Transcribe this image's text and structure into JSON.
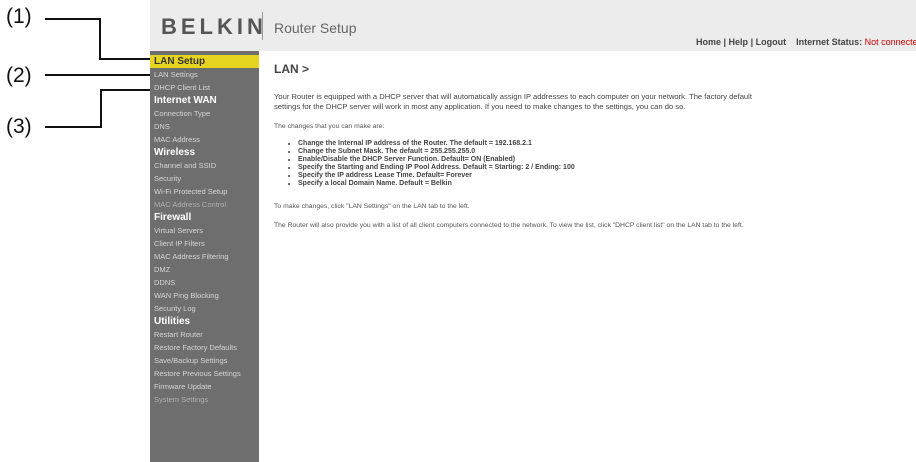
{
  "callouts": [
    "(1)",
    "(2)",
    "(3)"
  ],
  "header": {
    "logo": "BELKIN",
    "title": "Router Setup",
    "links": [
      "Home",
      "Help",
      "Logout"
    ],
    "status_label": "Internet Status:",
    "status_value": "Not connected"
  },
  "sidebar": {
    "lan_setup": {
      "title": "LAN Setup",
      "items": [
        "LAN Settings",
        "DHCP Client List"
      ]
    },
    "internet_wan": {
      "title": "Internet WAN",
      "items": [
        "Connection Type",
        "DNS",
        "MAC Address"
      ]
    },
    "wireless": {
      "title": "Wireless",
      "items": [
        "Channel and SSID",
        "Security",
        "Wi-Fi Protected Setup",
        "MAC Address Control"
      ]
    },
    "firewall": {
      "title": "Firewall",
      "items": [
        "Virtual Servers",
        "Client IP Filters",
        "MAC Address Filtering",
        "DMZ",
        "DDNS",
        "WAN Ping Blocking",
        "Security Log"
      ]
    },
    "utilities": {
      "title": "Utilities",
      "items": [
        "Restart Router",
        "Restore Factory Defaults",
        "Save/Backup Settings",
        "Restore Previous Settings",
        "Firmware Update",
        "System Settings"
      ]
    }
  },
  "content": {
    "title": "LAN >",
    "intro": "Your Router is equipped with a DHCP server that will automatically assign IP addresses to each computer on your network. The factory default settings for the DHCP server will work in most any application. If you need to make changes to the settings, you can do so.",
    "changes_intro": "The changes that you can make are:",
    "bullets": [
      "Change the Internal IP address of the Router. The default = 192.168.2.1",
      "Change the Subnet Mask. The default = 255.255.255.0",
      "Enable/Disable the DHCP Server Function. Default= ON (Enabled)",
      "Specify the Starting and Ending IP Pool Address. Default = Starting: 2 / Ending: 100",
      "Specify the IP address Lease Time. Default= Forever",
      "Specify a local Domain Name. Default = Belkin"
    ],
    "note1": "To make changes, click \"LAN Settings\" on the LAN tab to the left.",
    "note2": "The Router will also provide you with a list of all client computers connected to the network. To view the list, click \"DHCP client list\" on the LAN tab to the left."
  }
}
